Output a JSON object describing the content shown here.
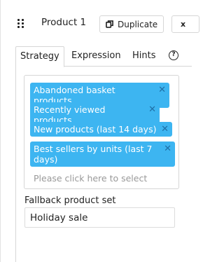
{
  "header": {
    "title": "Product 1",
    "duplicate_label": "Duplicate",
    "close_label": "x"
  },
  "tabs": [
    {
      "label": "Strategy",
      "active": true
    },
    {
      "label": "Expression",
      "active": false
    },
    {
      "label": "Hints",
      "active": false
    }
  ],
  "help_icon": "?",
  "strategy": {
    "selected": [
      {
        "label": "Abandoned basket products",
        "remove": "✕"
      },
      {
        "label": "Recently viewed products",
        "remove": "✕"
      },
      {
        "label": "New products (last 14 days)",
        "remove": "✕"
      },
      {
        "label": "Best sellers by units (last 7 days)",
        "remove": "✕"
      }
    ],
    "placeholder": "Please click here to select"
  },
  "fallback": {
    "label": "Fallback product set",
    "value": "Holiday sale"
  },
  "colors": {
    "chip_bg": "#3db5f1",
    "chip_text": "#ffffff"
  }
}
